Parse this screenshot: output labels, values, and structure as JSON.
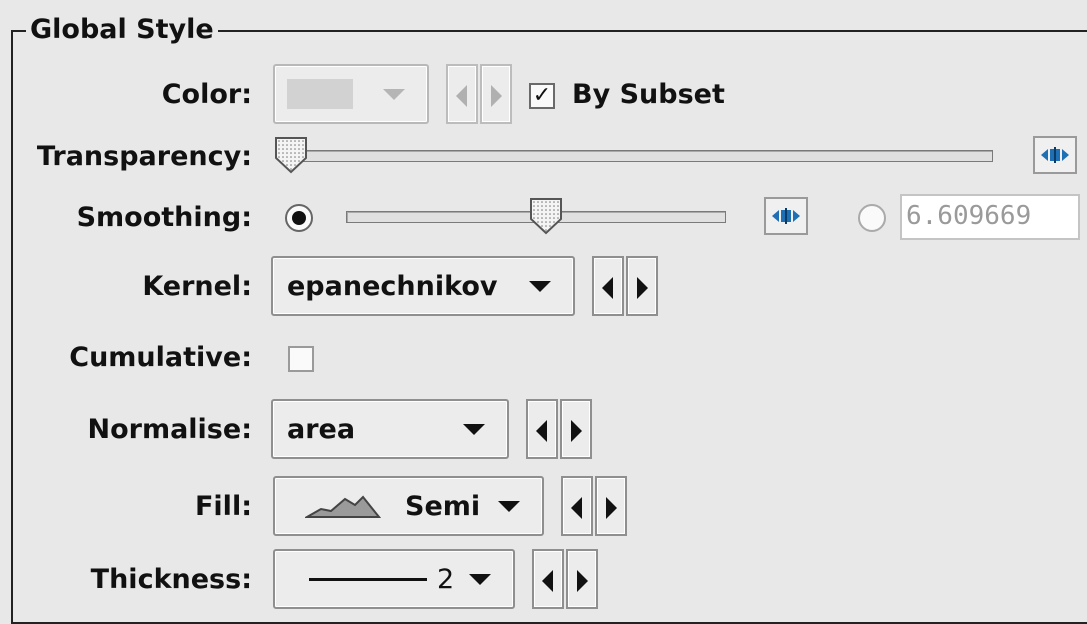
{
  "panel": {
    "title": "Global Style"
  },
  "labels": {
    "color": "Color:",
    "transparency": "Transparency:",
    "smoothing": "Smoothing:",
    "kernel": "Kernel:",
    "cumulative": "Cumulative:",
    "normalise": "Normalise:",
    "fill": "Fill:",
    "thickness": "Thickness:"
  },
  "color": {
    "enabled": false,
    "by_subset_label": "By Subset",
    "by_subset_checked": true
  },
  "transparency": {
    "value_fraction": 0.0
  },
  "smoothing": {
    "slider_selected": true,
    "slider_fraction": 0.52,
    "text_value": "6.609669"
  },
  "kernel": {
    "value": "epanechnikov"
  },
  "cumulative": {
    "checked": false
  },
  "normalise": {
    "value": "area"
  },
  "fill": {
    "value": "Semi",
    "icon": "histogram-semi-fill-icon"
  },
  "thickness": {
    "value": "2",
    "icon": "line-thickness-icon"
  }
}
